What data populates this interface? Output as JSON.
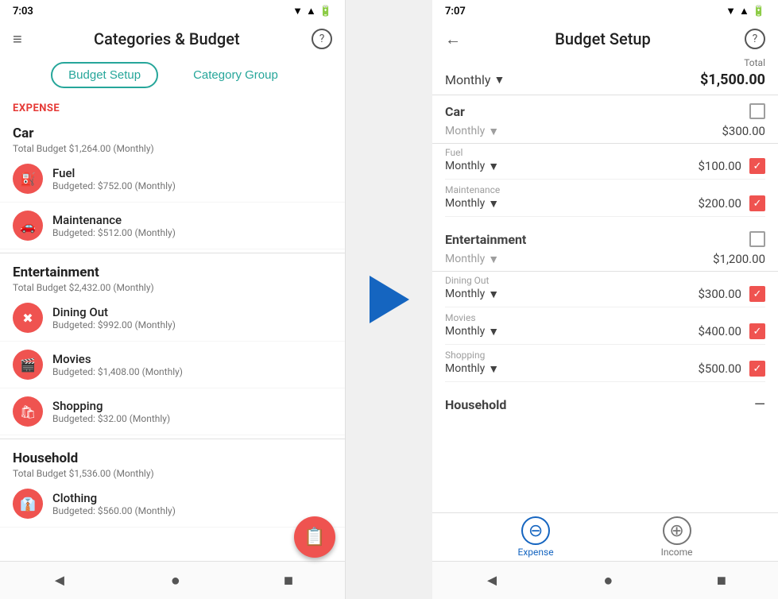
{
  "left": {
    "status_time": "7:03",
    "title": "Categories & Budget",
    "tabs": [
      {
        "label": "Budget Setup",
        "active": true
      },
      {
        "label": "Category Group",
        "active": false
      }
    ],
    "expense_label": "EXPENSE",
    "groups": [
      {
        "name": "Car",
        "budget": "Total Budget $1,264.00 (Monthly)",
        "items": [
          {
            "icon": "⛽",
            "name": "Fuel",
            "budget": "Budgeted: $752.00 (Monthly)"
          },
          {
            "icon": "🚗",
            "name": "Maintenance",
            "budget": "Budgeted: $512.00 (Monthly)"
          }
        ]
      },
      {
        "name": "Entertainment",
        "budget": "Total Budget $2,432.00 (Monthly)",
        "items": [
          {
            "icon": "✖",
            "name": "Dining Out",
            "budget": "Budgeted: $992.00 (Monthly)"
          },
          {
            "icon": "🎬",
            "name": "Movies",
            "budget": "Budgeted: $1,408.00 (Monthly)"
          },
          {
            "icon": "🛍",
            "name": "Shopping",
            "budget": "Budgeted: $32.00 (Monthly)"
          }
        ]
      },
      {
        "name": "Household",
        "budget": "Total Budget $1,536.00 (Monthly)",
        "items": [
          {
            "icon": "👔",
            "name": "Clothing",
            "budget": "Budgeted: $560.00 (Monthly)"
          }
        ]
      }
    ],
    "fab_icon": "📋",
    "nav": [
      "◄",
      "●",
      "■"
    ]
  },
  "right": {
    "status_time": "7:07",
    "title": "Budget Setup",
    "total_label": "Total",
    "global_monthly": "Monthly",
    "global_total": "$1,500.00",
    "groups": [
      {
        "name": "Car",
        "monthly_label": "Monthly",
        "amount": "$300.00",
        "checked": false,
        "items": [
          {
            "sub_label": "Fuel",
            "monthly": "Monthly",
            "amount": "$100.00",
            "checked": true
          },
          {
            "sub_label": "Maintenance",
            "monthly": "Monthly",
            "amount": "$200.00",
            "checked": true
          }
        ]
      },
      {
        "name": "Entertainment",
        "monthly_label": "Monthly",
        "amount": "$1,200.00",
        "checked": false,
        "items": [
          {
            "sub_label": "Dining Out",
            "monthly": "Monthly",
            "amount": "$300.00",
            "checked": true
          },
          {
            "sub_label": "Movies",
            "monthly": "Monthly",
            "amount": "$400.00",
            "checked": true
          },
          {
            "sub_label": "Shopping",
            "monthly": "Monthly",
            "amount": "$500.00",
            "checked": true
          }
        ]
      },
      {
        "name": "Household",
        "monthly_label": "",
        "amount": "",
        "checked": null,
        "items": []
      }
    ],
    "bottom_actions": [
      {
        "icon": "⊖",
        "label": "Expense",
        "color": "#1565c0"
      },
      {
        "icon": "⊕",
        "label": "Income",
        "color": "#757575"
      }
    ],
    "nav": [
      "◄",
      "●",
      "■"
    ]
  }
}
